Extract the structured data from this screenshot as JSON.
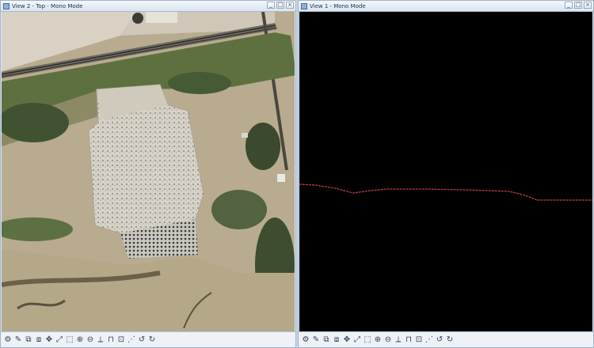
{
  "views": [
    {
      "title": "View 2 - Top - Mono Mode",
      "window_buttons": [
        "_",
        "□",
        "×"
      ],
      "content": "aerial-imagery"
    },
    {
      "title": "View 1 - Mono Mode",
      "window_buttons": [
        "_",
        "□",
        "×"
      ],
      "content": "profile"
    }
  ],
  "toolbar": {
    "tools": [
      {
        "name": "settings-icon",
        "glyph": "⚙"
      },
      {
        "name": "brush-icon",
        "glyph": "✎"
      },
      {
        "name": "copy-view-icon",
        "glyph": "⧉"
      },
      {
        "name": "stack-icon",
        "glyph": "⧈"
      },
      {
        "name": "pan-icon",
        "glyph": "✥"
      },
      {
        "name": "fit-icon",
        "glyph": "⤢"
      },
      {
        "name": "window-zoom-icon",
        "glyph": "⬚"
      },
      {
        "name": "zoom-in-icon",
        "glyph": "⊕"
      },
      {
        "name": "zoom-out-icon",
        "glyph": "⊖"
      },
      {
        "name": "measure-icon",
        "glyph": "⟂"
      },
      {
        "name": "frame-icon",
        "glyph": "⊓"
      },
      {
        "name": "box-icon",
        "glyph": "⊡"
      },
      {
        "name": "select-icon",
        "glyph": "⋰"
      },
      {
        "name": "undo-icon",
        "glyph": "↺"
      },
      {
        "name": "redo-icon",
        "glyph": "↻"
      }
    ]
  },
  "colors": {
    "profile_line": "#c23b3b",
    "profile_background": "#000000"
  }
}
